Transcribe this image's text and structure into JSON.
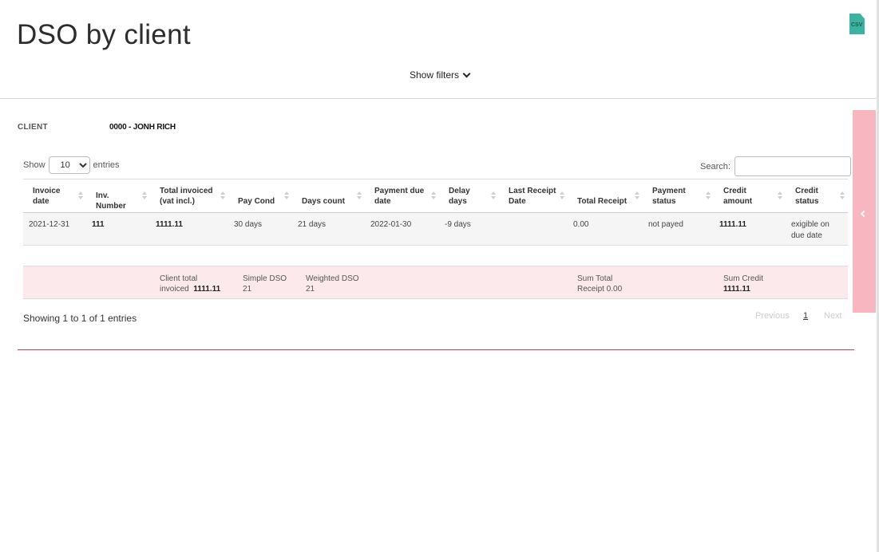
{
  "page": {
    "title": "DSO by client",
    "export_label": "CSV"
  },
  "filters": {
    "toggle_label": "Show filters"
  },
  "client": {
    "label": "CLIENT",
    "value": "0000 - JONH RICH"
  },
  "length_control": {
    "show_label": "Show",
    "selected": "10",
    "entries_label": "entries"
  },
  "search": {
    "label": "Search:",
    "value": ""
  },
  "table": {
    "headers": [
      {
        "l1": "Invoice",
        "l2": "date"
      },
      {
        "l1": "",
        "l2": "Inv. Number"
      },
      {
        "l1": "Total invoiced",
        "l2": "(vat incl.)"
      },
      {
        "l1": "",
        "l2": "Pay Cond"
      },
      {
        "l1": "",
        "l2": "Days count"
      },
      {
        "l1": "Payment due",
        "l2": "date"
      },
      {
        "l1": "Delay",
        "l2": "days"
      },
      {
        "l1": "Last Receipt",
        "l2": "Date"
      },
      {
        "l1": "",
        "l2": "Total Receipt"
      },
      {
        "l1": "Payment",
        "l2": "status"
      },
      {
        "l1": "Credit",
        "l2": "amount"
      },
      {
        "l1": "Credit",
        "l2": "status"
      }
    ],
    "rows": [
      {
        "invoice_date": "2021-12-31",
        "inv_number": "111",
        "total_invoiced": "1111.11",
        "pay_cond": "30 days",
        "days_count": "21 days",
        "payment_due_date": "2022-01-30",
        "delay_days": "-9 days",
        "last_receipt_date": "",
        "total_receipt": "0.00",
        "payment_status": "not payed",
        "credit_amount": "1111.11",
        "credit_status_l1": "exigible on",
        "credit_status_l2": "due date"
      }
    ]
  },
  "summary": {
    "client_total_l1": "Client total",
    "client_total_l2": "invoiced",
    "client_total_value": "1111.11",
    "simple_dso_label": "Simple DSO",
    "simple_dso_value": "21",
    "weighted_dso_label": "Weighted DSO",
    "weighted_dso_value": "21",
    "sum_receipt_l1": "Sum Total",
    "sum_receipt_l2": "Receipt 0.00",
    "sum_credit_label": "Sum Credit",
    "sum_credit_value": "1111.11"
  },
  "pagination": {
    "info": "Showing 1 to 1 of 1 entries",
    "previous": "Previous",
    "current_page": "1",
    "next": "Next"
  },
  "colors": {
    "accent_red": "#c8414f",
    "side_tab": "#f8b6c1",
    "summary_bg": "#fbe9ec",
    "csv_icon": "#3bb3a0"
  },
  "icons": {
    "export": "csv-file-icon",
    "filters": "chevron-down-icon",
    "side_tab": "chevron-left-icon"
  }
}
